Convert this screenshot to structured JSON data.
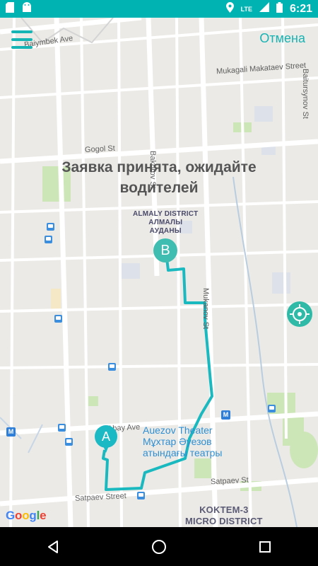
{
  "status_bar": {
    "lte": "LTE",
    "time": "6:21"
  },
  "header": {
    "cancel_label": "Отмена"
  },
  "message": {
    "line1": "Заявка принята, ожидайте",
    "line2": "водителей"
  },
  "map": {
    "streets": {
      "baiymbek": "Baiymbek Ave",
      "mukagali": "Mukagali Makataev Street",
      "baitursynov": "Baitursynov St",
      "gogol": "Gogol St",
      "bakorov": "Bakorov St",
      "mukanov": "Mukanov St",
      "abay": "Abay Ave",
      "satpaev_street": "Satpaev Street",
      "satpaev_st": "Satpaev St"
    },
    "district_almaly": {
      "line1": "ALMALY DISTRICT",
      "line2": "АЛМАЛЫ",
      "line3": "АУДАНЫ"
    },
    "district_koktem": {
      "line1": "KOKTEM-3",
      "line2": "MICRO DISTRICT"
    },
    "poi_auezov": {
      "line1": "Auezov Theater",
      "line2": "Мұхтар Әуезов",
      "line3": "атындағы театры"
    },
    "marker_a": "A",
    "marker_b": "B",
    "metro_label": "M"
  },
  "google_logo": {
    "g1": "G",
    "g2": "o",
    "g3": "o",
    "g4": "g",
    "g5": "l",
    "g6": "e"
  },
  "colors": {
    "accent": "#16b5b5",
    "route": "#1ab9c0",
    "status_bar": "#00b3b3"
  }
}
